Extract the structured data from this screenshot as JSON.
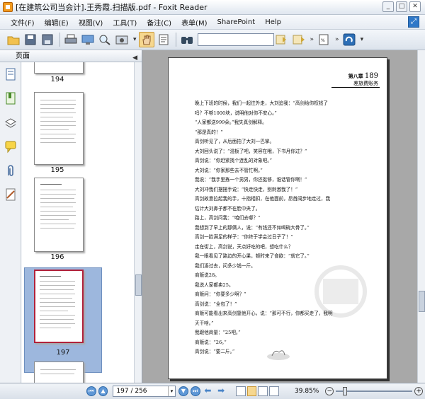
{
  "window": {
    "title": "[在建筑公司当会计].王秀霞.扫描版.pdf - Foxit Reader",
    "buttons": [
      "minimize",
      "maximize",
      "close"
    ]
  },
  "menu": {
    "items": [
      "文件(F)",
      "编辑(E)",
      "视图(V)",
      "工具(T)",
      "备注(C)",
      "表单(M)",
      "SharePoint",
      "Help"
    ]
  },
  "toolbar": {
    "search_placeholder": "",
    "icons": [
      "open-icon",
      "save-icon",
      "save-as-icon",
      "print-icon",
      "screen-icon",
      "zoom-icon",
      "snapshot-icon",
      "hand-icon",
      "select-text-icon",
      "find-icon",
      "search-prev-icon",
      "search-next-icon",
      "fit-page-icon",
      "rotate-icon"
    ]
  },
  "left_pane": {
    "header": "页面",
    "thumbnails": [
      {
        "page": "194"
      },
      {
        "page": "195"
      },
      {
        "page": "196"
      },
      {
        "page": "197",
        "selected": true
      }
    ]
  },
  "document": {
    "header_chapter": "第八章",
    "header_sub": "差旅费账务",
    "header_page": "189",
    "paragraphs": [
      "晚上下班的时候，我们一起往外走，大刘追我：“高剑给你权钱了",
      "吗？不够1000块，说明他对你不安心。”",
      "“人家都送999朵。”我失真剑解释。",
      "“那是真的！”",
      "高剑听见了，从后面拍了大刘一巴掌。",
      "大刘回头说了：“混板了吧，笑容在哦，下书月你过？”",
      "高剑说：“你赶紧找个连乱的对象吧。”",
      "大刘说：“你家那些去不管忙啊。”",
      "我说：“我手里拣一个男男，你还挺够，谁话管你啊！”",
      "大刘冲我们摆摆手说：“快走快走，别刺激我了！”",
      "高剑故意拉起我的手，十指相扣，在他面前，昂首阔步地走过，我",
      "估计大刘鼻子都不在脸中央了。",
      "路上，高剑问我：“咱们去哪？”",
      "我想到了早上的那俩人，说：“有钱还不如喝碗大骨了。”",
      "高剑一脸满足的样子：“你终于学会过日子了！”",
      "走在街上，高剑说，天点好吃的吧，想吃什么？",
      "我一眼看见了路边的开心果，顿时来了食欲：“就它了。”",
      "我们凑过去，问多少钱一斤。",
      "商贩说28。",
      "我说人家都卖25。",
      "商贩问：“你要多少啊？”",
      "高剑说：“全包了！”",
      "商贩可能看出来高剑靠他开心，说：“那可不行，你都买走了，我明",
      "天干啥。”",
      "我跟他商量：“25吧。”",
      "商贩说：“26。”",
      "高剑说：“要二斤。”"
    ]
  },
  "statusbar": {
    "page_input": "197 / 256",
    "zoom": "39.85%"
  },
  "colors": {
    "selection": "#9db7dd",
    "active_tool": "#f6d78f",
    "doc_background": "#a8a8a8"
  }
}
